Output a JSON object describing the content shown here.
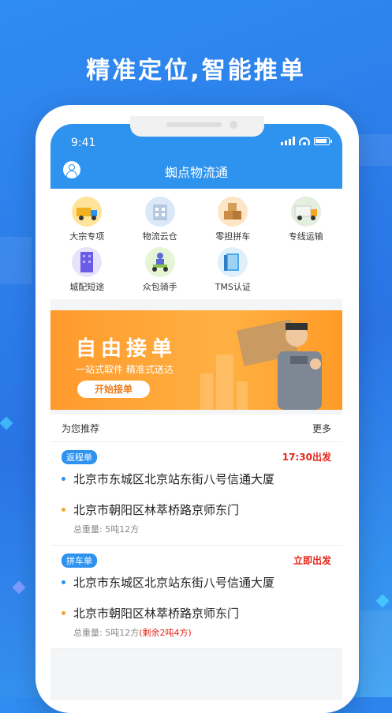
{
  "headline": "精准定位,智能推单",
  "status_bar": {
    "time": "9:41"
  },
  "app": {
    "title": "蜘点物流通"
  },
  "services": [
    {
      "label": "大宗专项",
      "icon": "bulk-truck-icon"
    },
    {
      "label": "物流云仓",
      "icon": "cloud-warehouse-icon"
    },
    {
      "label": "零担拼车",
      "icon": "parcel-boxes-icon"
    },
    {
      "label": "专线运输",
      "icon": "delivery-truck-icon"
    },
    {
      "label": "城配短途",
      "icon": "city-building-icon"
    },
    {
      "label": "众包骑手",
      "icon": "scooter-rider-icon"
    },
    {
      "label": "TMS认证",
      "icon": "tms-book-icon"
    }
  ],
  "banner": {
    "title": "自由接单",
    "subtitle": "一站式取件 精准式送达",
    "button": "开始接单"
  },
  "recommend": {
    "title": "为您推荐",
    "more": "更多",
    "orders": [
      {
        "tag": "返程单",
        "depart": "17:30出发",
        "from": "北京市东城区北京站东街八号信通大厦",
        "to": "北京市朝阳区林萃桥路京师东门",
        "weight_label": "总重量:",
        "weight_value": "5吨12方",
        "remaining": ""
      },
      {
        "tag": "拼车单",
        "depart": "立即出发",
        "from": "北京市东城区北京站东街八号信通大厦",
        "to": "北京市朝阳区林萃桥路京师东门",
        "weight_label": "总重量:",
        "weight_value": "5吨12方",
        "remaining": "(剩余2吨4方)"
      }
    ]
  },
  "colors": {
    "brand_blue": "#2e93ef",
    "accent_orange": "#ff9a2d",
    "alert_red": "#e5271b",
    "from_dot": "#2e93ef",
    "to_dot": "#f5a623"
  }
}
